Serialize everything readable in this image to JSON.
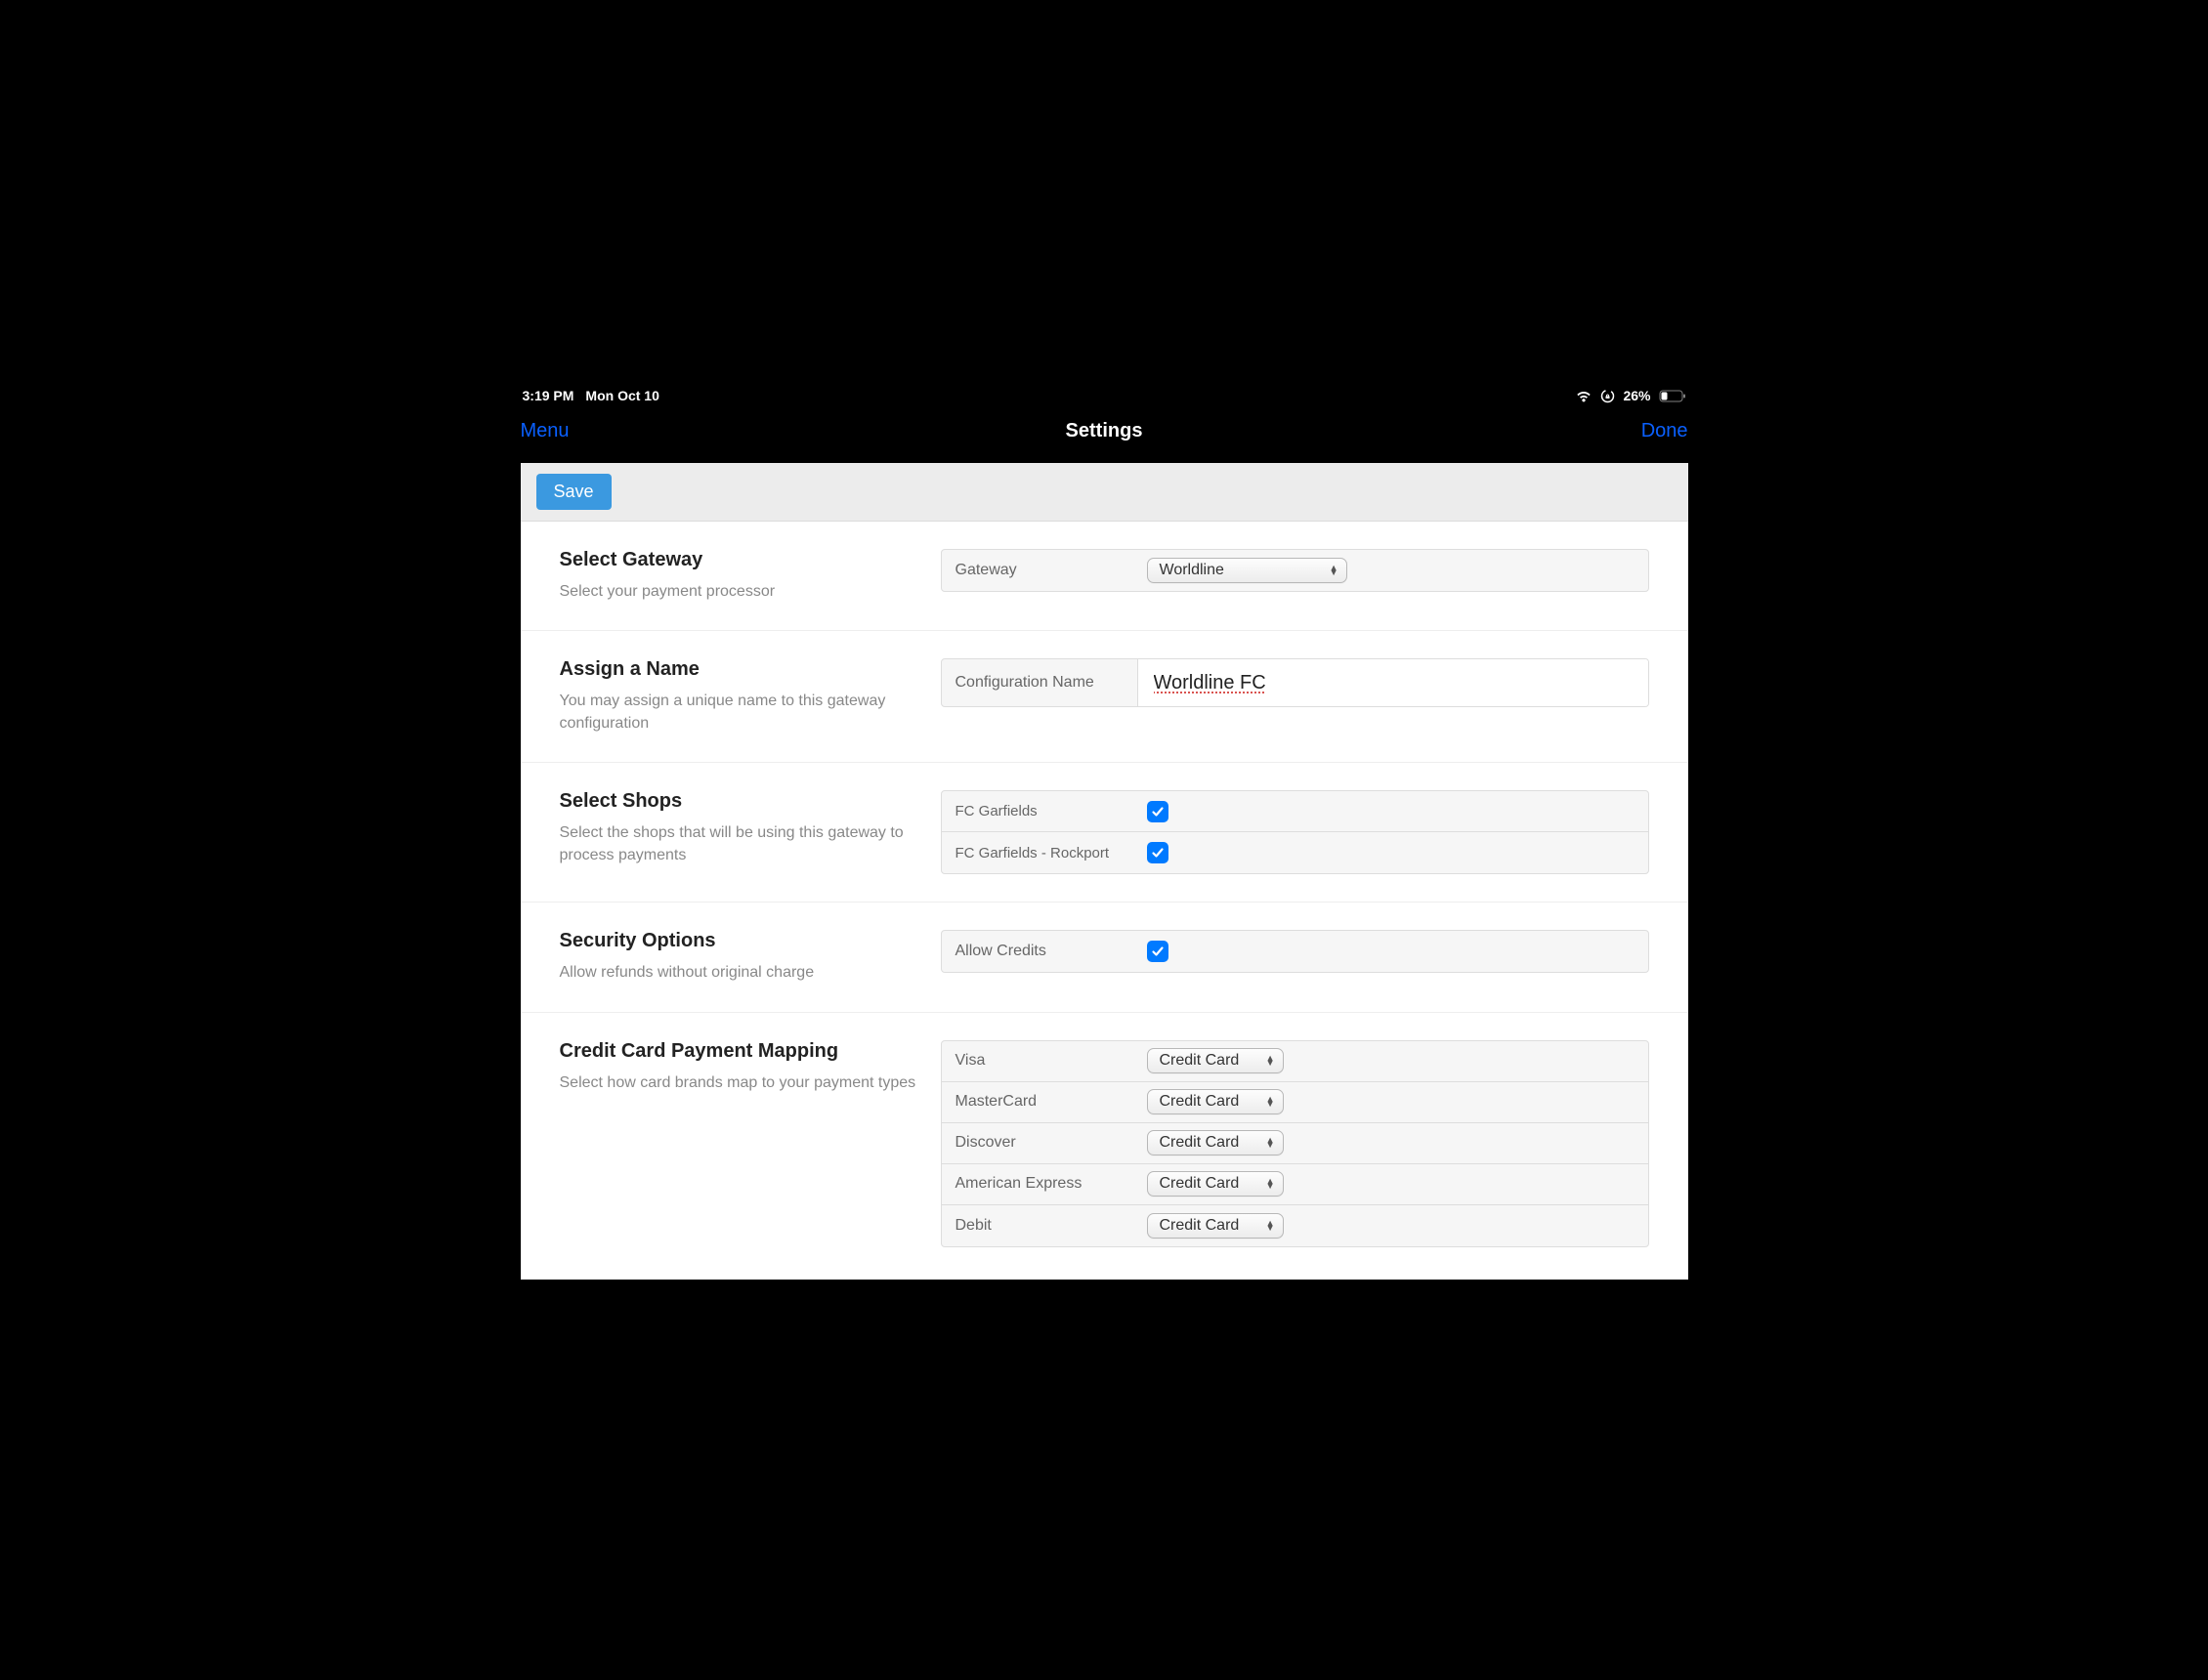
{
  "status": {
    "time": "3:19 PM",
    "date": "Mon Oct 10",
    "battery": "26%"
  },
  "nav": {
    "menu": "Menu",
    "title": "Settings",
    "done": "Done"
  },
  "toolbar": {
    "save": "Save"
  },
  "sections": {
    "gateway": {
      "title": "Select Gateway",
      "desc": "Select your payment processor",
      "label": "Gateway",
      "value": "Worldline"
    },
    "name": {
      "title": "Assign a Name",
      "desc": "You may assign a unique name to this gateway configuration",
      "label": "Configuration Name",
      "value": "Worldline FC"
    },
    "shops": {
      "title": "Select Shops",
      "desc": "Select the shops that will be using this gateway to process payments",
      "items": [
        {
          "label": "FC Garfields",
          "checked": true
        },
        {
          "label": "FC Garfields - Rockport",
          "checked": true
        }
      ]
    },
    "security": {
      "title": "Security Options",
      "desc": "Allow refunds without original charge",
      "label": "Allow Credits",
      "checked": true
    },
    "mapping": {
      "title": "Credit Card Payment Mapping",
      "desc": "Select how card brands map to your payment types",
      "rows": [
        {
          "label": "Visa",
          "value": "Credit Card"
        },
        {
          "label": "MasterCard",
          "value": "Credit Card"
        },
        {
          "label": "Discover",
          "value": "Credit Card"
        },
        {
          "label": "American Express",
          "value": "Credit Card"
        },
        {
          "label": "Debit",
          "value": "Credit Card"
        }
      ]
    }
  }
}
